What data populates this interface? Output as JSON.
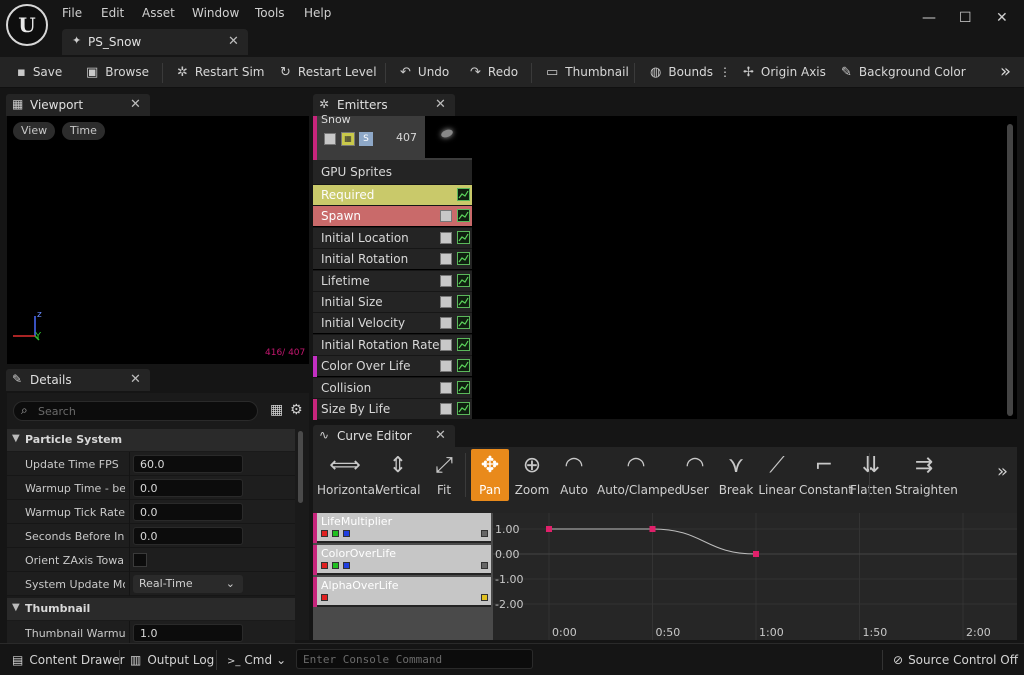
{
  "menu": [
    "File",
    "Edit",
    "Asset",
    "Window",
    "Tools",
    "Help"
  ],
  "document_tab": {
    "label": "PS_Snow"
  },
  "toolbar": {
    "save": "Save",
    "browse": "Browse",
    "restart_sim": "Restart Sim",
    "restart_level": "Restart Level",
    "undo": "Undo",
    "redo": "Redo",
    "thumbnail": "Thumbnail",
    "bounds": "Bounds",
    "origin_axis": "Origin Axis",
    "background_color": "Background Color"
  },
  "viewport": {
    "tab": "Viewport",
    "view_btn": "View",
    "time_btn": "Time",
    "axis_z": "z",
    "axis_y": "Y",
    "counter": "416/ 407"
  },
  "details": {
    "tab": "Details",
    "search_placeholder": "Search",
    "sections": [
      {
        "name": "Particle System",
        "rows": [
          {
            "label": "Update Time FPS",
            "value": "60.0"
          },
          {
            "label": "Warmup Time - be...",
            "value": "0.0"
          },
          {
            "label": "Warmup Tick Rate",
            "value": "0.0"
          },
          {
            "label": "Seconds Before Ina...",
            "value": "0.0"
          },
          {
            "label": "Orient ZAxis Towar...",
            "value": ""
          },
          {
            "label": "System Update Mo...",
            "value": "Real-Time"
          }
        ]
      },
      {
        "name": "Thumbnail",
        "rows": [
          {
            "label": "Thumbnail Warmup",
            "value": "1.0"
          }
        ]
      }
    ]
  },
  "emitters": {
    "tab": "Emitters",
    "emitter_name": "Snow",
    "emitter_badge": "S",
    "emitter_count": "407",
    "type_label": "GPU Sprites",
    "modules": [
      {
        "label": "Required",
        "color": "#c9c96a"
      },
      {
        "label": "Spawn",
        "color": "#c96a6a"
      },
      {
        "label": "Initial Location"
      },
      {
        "label": "Initial Rotation"
      },
      {
        "label": "Lifetime"
      },
      {
        "label": "Initial Size"
      },
      {
        "label": "Initial Velocity"
      },
      {
        "label": "Initial Rotation Rate"
      },
      {
        "label": "Color Over Life",
        "marker": "#c22fc2"
      },
      {
        "label": "Collision"
      },
      {
        "label": "Size By Life",
        "marker": "#c7257c"
      }
    ]
  },
  "curve_editor": {
    "tab": "Curve Editor",
    "tools": [
      "Horizontal",
      "Vertical",
      "Fit",
      "Pan",
      "Zoom",
      "Auto",
      "Auto/Clamped",
      "User",
      "Break",
      "Linear",
      "Constant",
      "Flatten",
      "Straighten"
    ],
    "active_tool": "Pan",
    "tracks": [
      "LifeMultiplier",
      "ColorOverLife",
      "AlphaOverLife"
    ],
    "y_ticks": [
      "1.00",
      "0.00",
      "-1.00",
      "-2.00"
    ],
    "x_ticks": [
      "0:00",
      "0:50",
      "1:00",
      "1:50",
      "2:00"
    ],
    "keys": [
      {
        "t": 0.0,
        "v": 1.0
      },
      {
        "t": 0.5,
        "v": 1.0
      },
      {
        "t": 1.0,
        "v": 0.0
      }
    ]
  },
  "statusbar": {
    "content_drawer": "Content Drawer",
    "output_log": "Output Log",
    "cmd": "Cmd",
    "console_placeholder": "Enter Console Command",
    "source_control": "Source Control Off"
  }
}
